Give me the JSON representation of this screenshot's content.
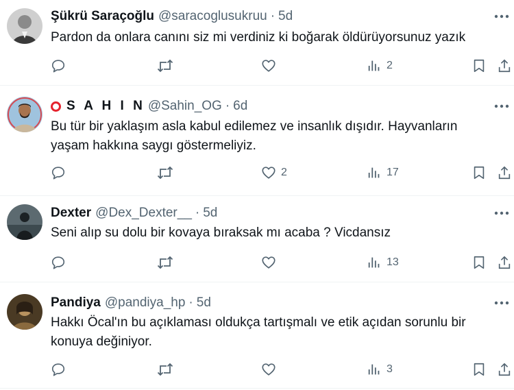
{
  "tweets": [
    {
      "name": "Şükrü Saraçoğlu",
      "handle": "@saracoglusukruu",
      "separator": "·",
      "time": "5d",
      "text_lines": [
        "Pardon da onlara canını siz mi verdiniz ki boğarak öldürüyorsunuz yazık"
      ],
      "likes": "",
      "views": "2"
    },
    {
      "name": "S A H I N",
      "handle": "@Sahin_OG",
      "separator": "·",
      "time": "6d",
      "text_lines": [
        "Bu tür bir yaklaşım asla kabul edilemez ve insanlık dışıdır. Hayvanların",
        "yaşam hakkına saygı göstermeliyiz."
      ],
      "likes": "2",
      "views": "17"
    },
    {
      "name": "Dexter",
      "handle": "@Dex_Dexter__",
      "separator": "·",
      "time": "5d",
      "text_lines": [
        "Seni alıp su dolu bir kovaya bıraksak mı acaba ? Vicdansız"
      ],
      "likes": "",
      "views": "13"
    },
    {
      "name": "Pandiya",
      "handle": "@pandiya_hp",
      "separator": "·",
      "time": "5d",
      "text_lines": [
        "Hakkı Öcal'ın bu açıklaması oldukça tartışmalı ve etik açıdan sorunlu bir",
        "konuya değiniyor."
      ],
      "likes": "",
      "views": "3"
    }
  ],
  "icons": {
    "more": "more-horizontal-icon",
    "reply": "reply-icon",
    "retweet": "retweet-icon",
    "like": "like-icon",
    "views": "views-icon",
    "bookmark": "bookmark-icon",
    "share": "share-icon"
  },
  "colors": {
    "text": "#0f1419",
    "secondary": "#536471",
    "divider": "#eff3f4",
    "sahin_ring": "#e5232e"
  }
}
